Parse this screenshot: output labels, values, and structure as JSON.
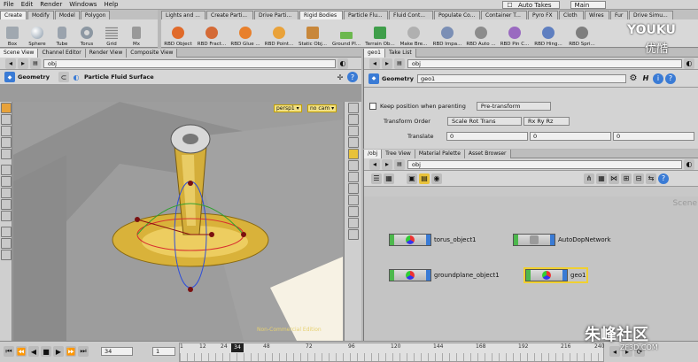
{
  "menu": {
    "items": [
      "File",
      "Edit",
      "Render",
      "Windows",
      "Help"
    ],
    "desk": "Auto Takes",
    "desk_select": "Main"
  },
  "shelf_tabs_left": [
    "Create",
    "Modify",
    "Model",
    "Polygon"
  ],
  "shelf_tabs_right": [
    "Lights and ...",
    "Create Parti...",
    "Drive Parti...",
    "Rigid Bodies",
    "Particle Flu...",
    "Fluid Cont...",
    "Populate Co...",
    "Container T...",
    "Pyro FX",
    "Cloth",
    "Wires",
    "Fur",
    "Drive Simu..."
  ],
  "shelf_tools_left": [
    "Box",
    "Sphere",
    "Tube",
    "Torus",
    "Grid",
    "Mx"
  ],
  "shelf_tools_right": [
    "RBD Object",
    "RBD Fract...",
    "RBD Glue ...",
    "RBD Point...",
    "Static Obj...",
    "Ground Pl...",
    "Terrain Ob...",
    "Make Bre...",
    "RBD Impa...",
    "RBD Auto ...",
    "RBD Pin C...",
    "RBD Hing...",
    "RBD Spri..."
  ],
  "left_panel": {
    "tabs": [
      "Scene View",
      "Channel Editor",
      "Render View",
      "Composite View"
    ],
    "path": "obj",
    "context_label": "Geometry",
    "object_name": "Particle Fluid Surface",
    "cam_persp": "persp1 ▾",
    "cam_none": "no cam ▾",
    "watermark_text": "Non-Commercial Edition"
  },
  "param_panel": {
    "tabs": [
      "geo1",
      "Take List"
    ],
    "path": "obj",
    "type_label": "Geometry",
    "node_name": "geo1",
    "keep_position_label": "Keep position when parenting",
    "keep_position_value": "Pre-transform",
    "transform_order_label": "Transform Order",
    "transform_order_value": "Scale Rot Trans",
    "rot_order_value": "Rx Ry Rz",
    "translate_label": "Translate",
    "translate_values": [
      "0",
      "0",
      "0"
    ]
  },
  "network_panel": {
    "tabs": [
      "/obj",
      "Tree View",
      "Material Palette",
      "Asset Browser"
    ],
    "path": "obj",
    "corner_label": "Scene",
    "nodes": [
      {
        "label": "torus_object1"
      },
      {
        "label": "AutoDopNetwork"
      },
      {
        "label": "groundplane_object1"
      },
      {
        "label": "geo1"
      }
    ]
  },
  "timeline": {
    "frame": "34",
    "start": "1",
    "ticks": [
      "1",
      "12",
      "24",
      "48",
      "72",
      "96",
      "120",
      "144",
      "168",
      "192",
      "216",
      "240"
    ],
    "current_marker": "34"
  },
  "overlay": {
    "youku": "YOUKU",
    "youku_cn": "优酷",
    "site_cn": "朱峰社区",
    "site_en": "ZF3D.COM"
  },
  "colors": {
    "accent": "#f5c542",
    "viewport_bg": "#9a9a9a",
    "sand": "#d9b23a"
  }
}
